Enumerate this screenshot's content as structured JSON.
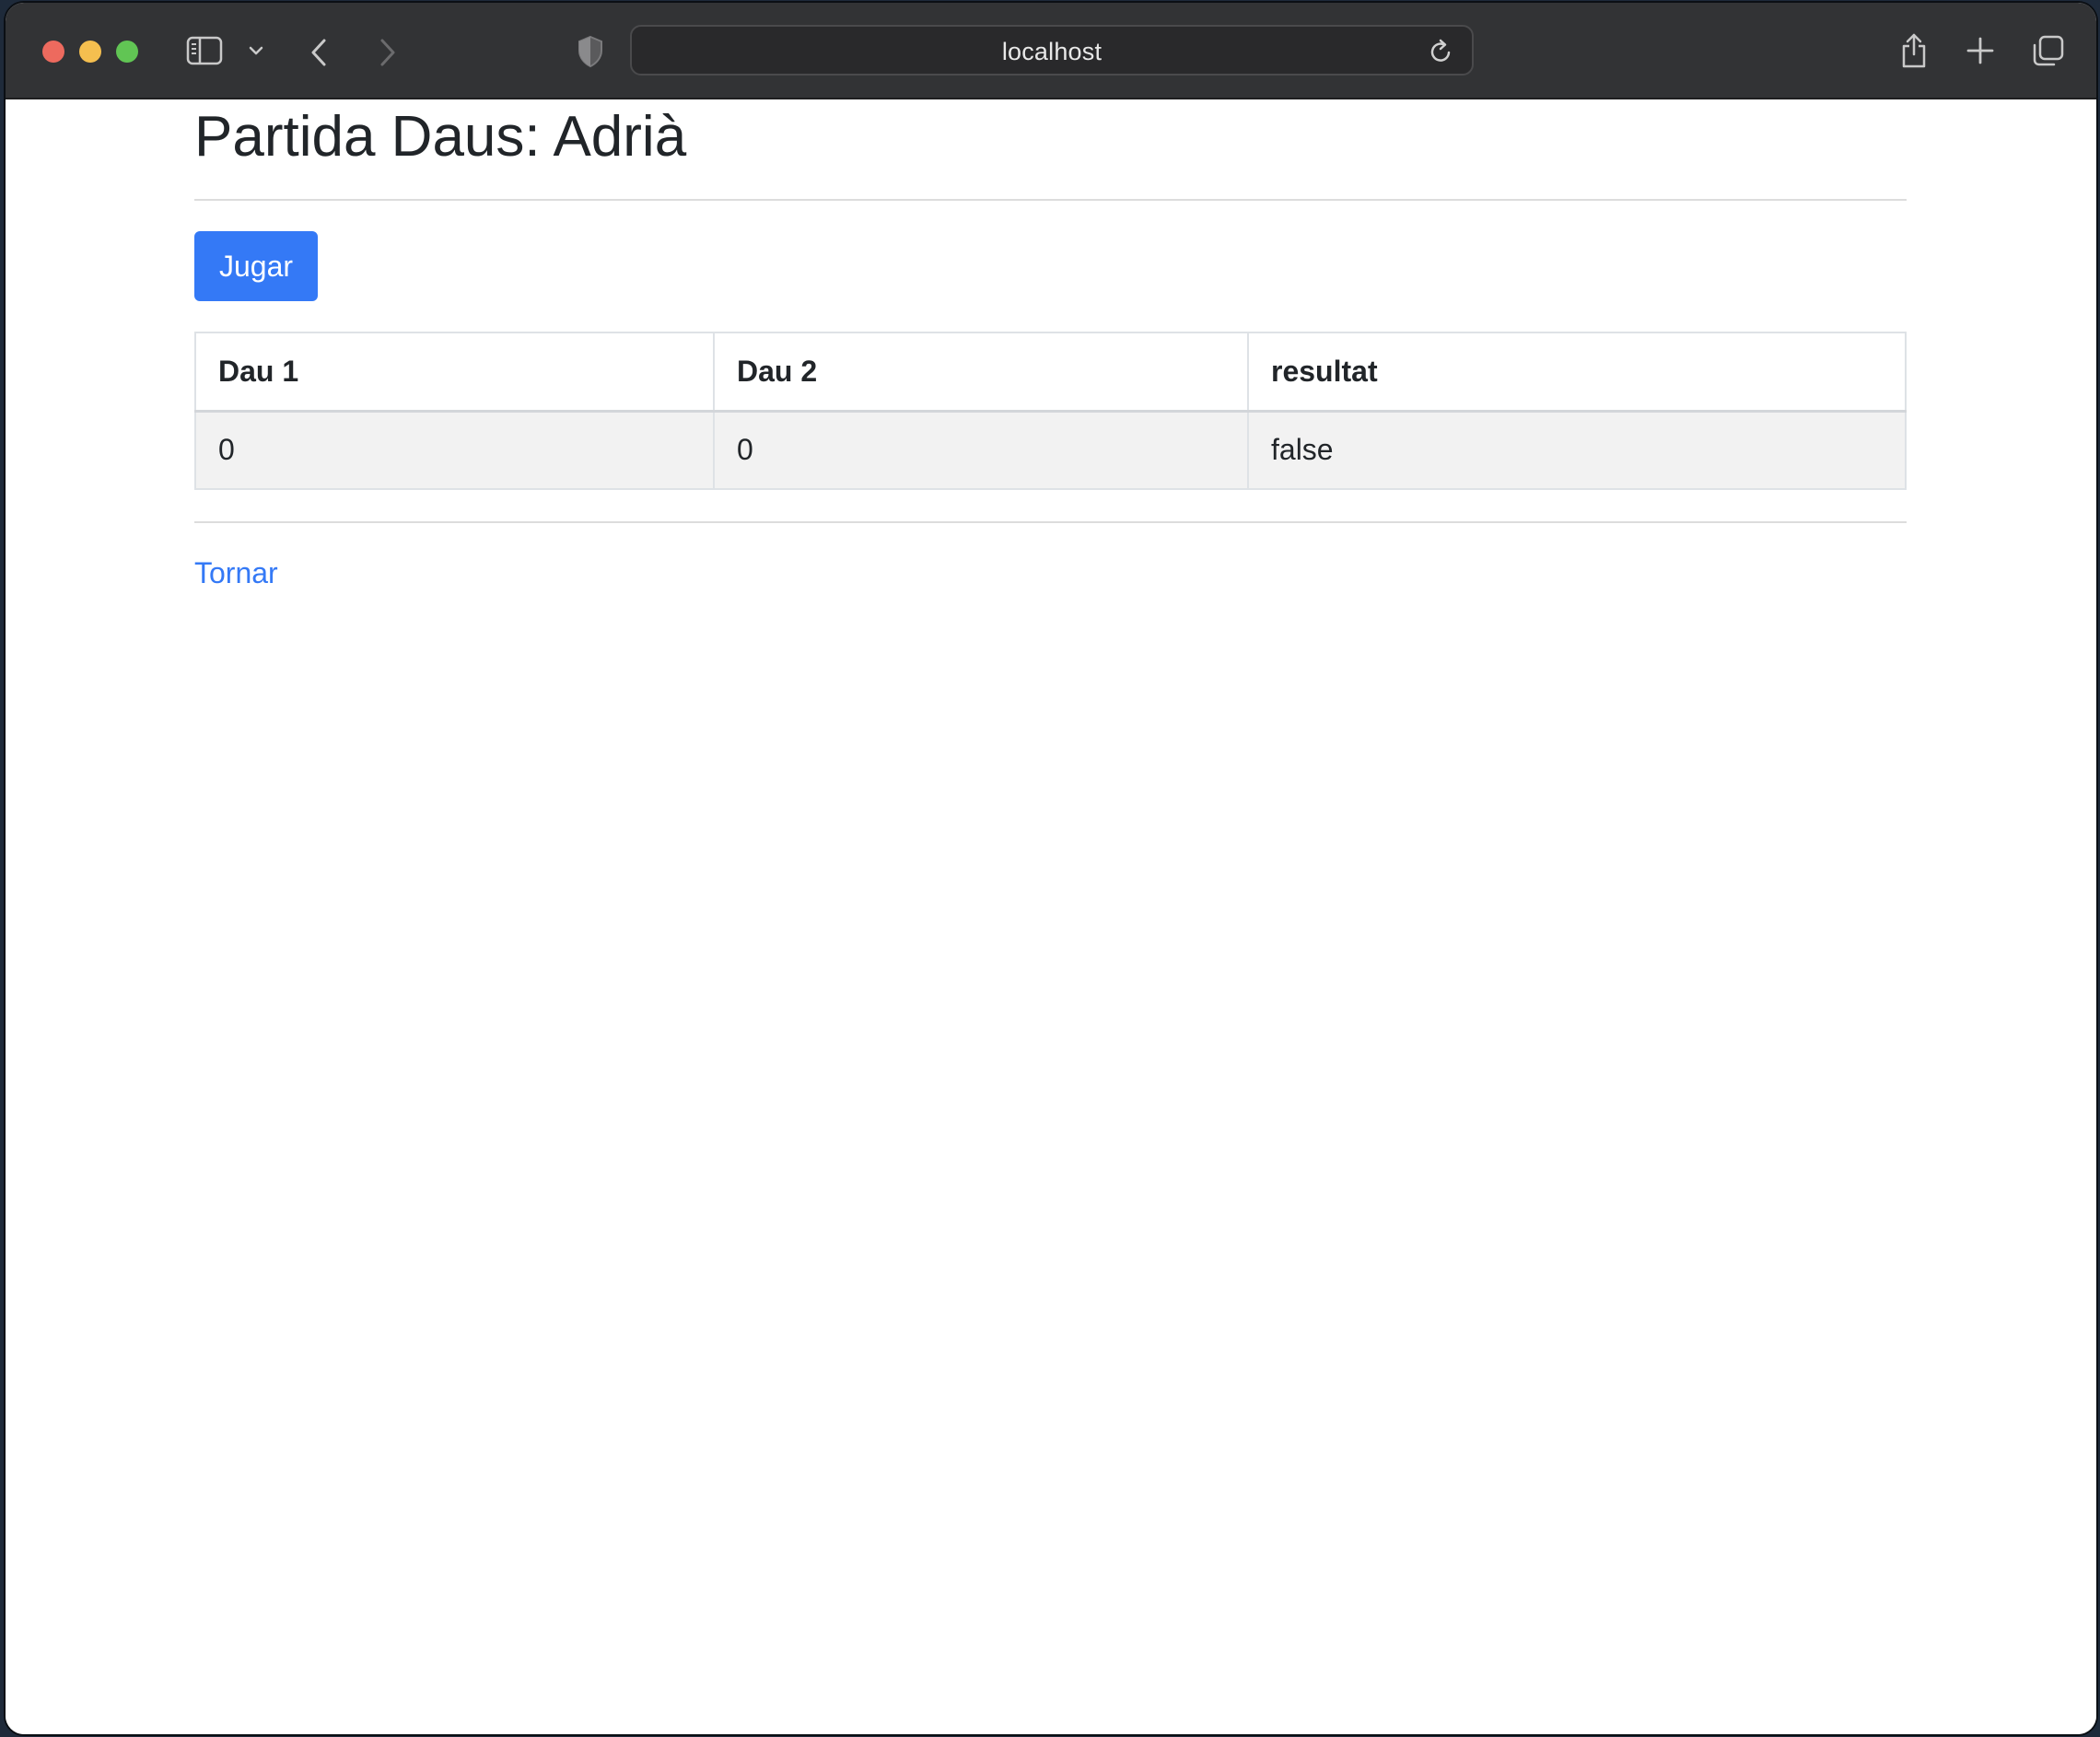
{
  "browser": {
    "address": "localhost"
  },
  "page": {
    "title": "Partida Daus: Adrià",
    "play_button": "Jugar",
    "table": {
      "headers": [
        "Dau 1",
        "Dau 2",
        "resultat"
      ],
      "rows": [
        [
          "0",
          "0",
          "false"
        ]
      ]
    },
    "back_link": "Tornar"
  },
  "colors": {
    "accent": "#3479f6",
    "toolbar": "#323335",
    "text": "#212529"
  }
}
